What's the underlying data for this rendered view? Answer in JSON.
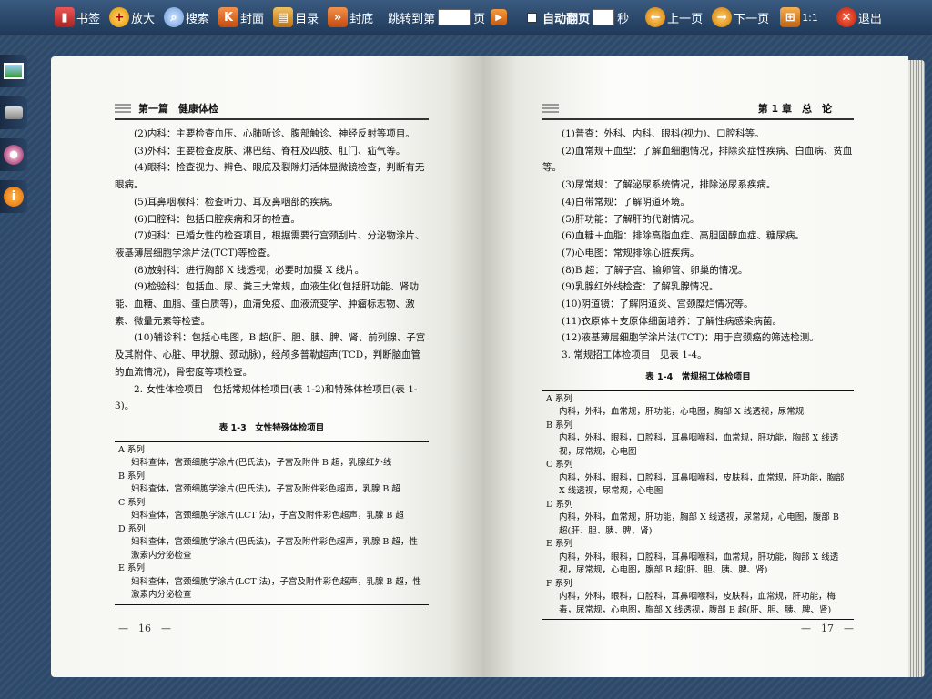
{
  "toolbar": {
    "bookmark": "书签",
    "zoom": "放大",
    "search": "搜索",
    "cover_front": "封面",
    "toc": "目录",
    "cover_back": "封底",
    "jump_prefix": "跳转到第",
    "jump_suffix": "页",
    "auto_flip": "自动翻页",
    "seconds": "秒",
    "prev": "上一页",
    "next": "下一页",
    "ratio": "1:1",
    "exit": "退出"
  },
  "left_page": {
    "header": "第一篇　健康体检",
    "paragraphs": [
      "(2)内科：主要检查血压、心肺听诊、腹部触诊、神经反射等项目。",
      "(3)外科：主要检查皮肤、淋巴结、脊柱及四肢、肛门、疝气等。",
      "(4)眼科：检查视力、辨色、眼底及裂隙灯活体显微镜检查，判断有无眼病。",
      "(5)耳鼻咽喉科：检查听力、耳及鼻咽部的疾病。",
      "(6)口腔科：包括口腔疾病和牙的检查。",
      "(7)妇科：已婚女性的检查项目，根据需要行宫颈刮片、分泌物涂片、液基薄层细胞学涂片法(TCT)等检查。",
      "(8)放射科：进行胸部 X 线透视，必要时加摄 X 线片。",
      "(9)检验科：包括血、尿、粪三大常规，血液生化(包括肝功能、肾功能、血糖、血脂、蛋白质等)，血清免疫、血液流变学、肿瘤标志物、激素、微量元素等检查。",
      "(10)辅诊科：包括心电图，B 超(肝、胆、胰、脾、肾、前列腺、子宫及其附件、心脏、甲状腺、颈动脉)，经颅多普勒超声(TCD，判断脑血管的血流情况)，骨密度等项检查。",
      "2. 女性体检项目　包括常规体检项目(表 1-2)和特殊体检项目(表 1-3)。"
    ],
    "table_title": "表 1-3　女性特殊体检项目",
    "table": [
      {
        "section": "A 系列",
        "content": "妇科查体，宫颈细胞学涂片(巴氏法)，子宫及附件 B 超，乳腺红外线"
      },
      {
        "section": "B 系列",
        "content": "妇科查体，宫颈细胞学涂片(巴氏法)，子宫及附件彩色超声，乳腺 B 超"
      },
      {
        "section": "C 系列",
        "content": "妇科查体，宫颈细胞学涂片(LCT 法)，子宫及附件彩色超声，乳腺 B 超"
      },
      {
        "section": "D 系列",
        "content": "妇科查体，宫颈细胞学涂片(巴氏法)，子宫及附件彩色超声，乳腺 B 超，性激素内分泌检查"
      },
      {
        "section": "E 系列",
        "content": "妇科查体，宫颈细胞学涂片(LCT 法)，子宫及附件彩色超声，乳腺 B 超，性激素内分泌检查"
      }
    ],
    "page_number": "—　16　—"
  },
  "right_page": {
    "header": "第 1 章　总　论",
    "paragraphs": [
      "(1)普查：外科、内科、眼科(视力)、口腔科等。",
      "(2)血常规＋血型：了解血细胞情况，排除炎症性疾病、白血病、贫血等。",
      "(3)尿常规：了解泌尿系统情况，排除泌尿系疾病。",
      "(4)白带常规：了解阴道环境。",
      "(5)肝功能：了解肝的代谢情况。",
      "(6)血糖＋血脂：排除高脂血症、高胆固醇血症、糖尿病。",
      "(7)心电图：常规排除心脏疾病。",
      "(8)B 超：了解子宫、输卵管、卵巢的情况。",
      "(9)乳腺红外线检查：了解乳腺情况。",
      "(10)阴道镜：了解阴道炎、宫颈糜烂情况等。",
      "(11)衣原体＋支原体细菌培养：了解性病感染病菌。",
      "(12)液基薄层细胞学涂片法(TCT)：用于宫颈癌的筛选检测。",
      "3. 常规招工体检项目　见表 1-4。"
    ],
    "table_title": "表 1-4　常规招工体检项目",
    "table": [
      {
        "section": "A 系列",
        "content": "内科，外科，血常规，肝功能，心电图，胸部 X 线透视，尿常规"
      },
      {
        "section": "B 系列",
        "content": "内科，外科，眼科，口腔科，耳鼻咽喉科，血常规，肝功能，胸部 X 线透视，尿常规，心电图"
      },
      {
        "section": "C 系列",
        "content": "内科，外科，眼科，口腔科，耳鼻咽喉科，皮肤科，血常规，肝功能，胸部 X 线透视，尿常规，心电图"
      },
      {
        "section": "D 系列",
        "content": "内科，外科，血常规，肝功能，胸部 X 线透视，尿常规，心电图，腹部 B 超(肝、胆、胰、脾、肾)"
      },
      {
        "section": "E 系列",
        "content": "内科，外科，眼科，口腔科，耳鼻咽喉科，血常规，肝功能，胸部 X 线透视，尿常规，心电图，腹部 B 超(肝、胆、胰、脾、肾)"
      },
      {
        "section": "F 系列",
        "content": "内科，外科，眼科，口腔科，耳鼻咽喉科，皮肤科，血常规，肝功能，梅毒，尿常规，心电图，胸部 X 线透视，腹部 B 超(肝、胆、胰、脾、肾)"
      }
    ],
    "page_number": "—　17　—"
  },
  "side_icons": [
    "gallery-icon",
    "print-icon",
    "settings-icon",
    "info-icon"
  ]
}
